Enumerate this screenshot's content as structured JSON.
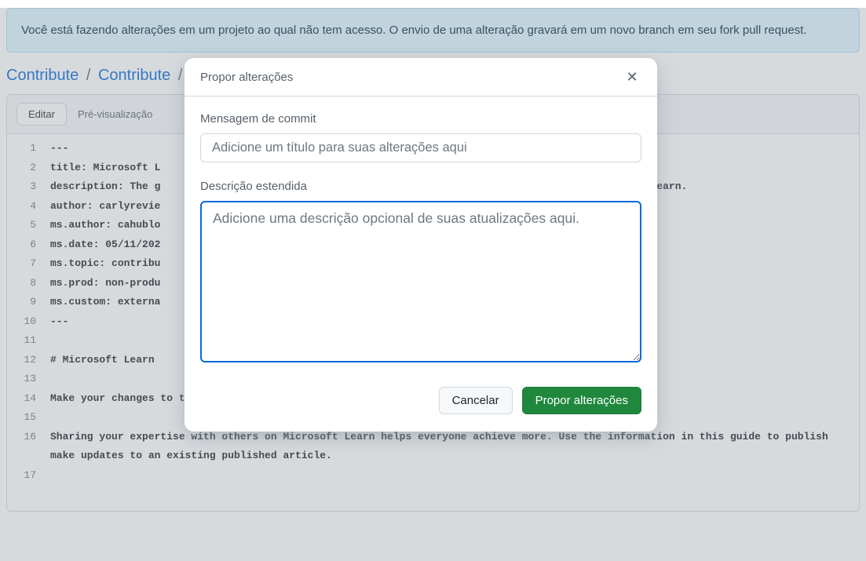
{
  "notice": {
    "text": "Você está fazendo alterações em um projeto ao qual não tem acesso. O envio de uma alteração gravará em um novo branch em seu fork pull request."
  },
  "breadcrumb": {
    "parts": [
      "Contribute",
      "Contribute"
    ],
    "sep": "/"
  },
  "tabs": {
    "edit": "Editar",
    "preview": "Pré-visualização"
  },
  "code": {
    "lineNumbers": [
      "1",
      "2",
      "3",
      "4",
      "5",
      "6",
      "7",
      "8",
      "9",
      "10",
      "11",
      "12",
      "13",
      "14",
      "15",
      "16",
      "",
      "17"
    ],
    "lines": [
      "---",
      "title: Microsoft L",
      "description: The g                                                                           soft Learn.",
      "author: carlyrevie",
      "ms.author: cahublo",
      "ms.date: 05/11/202",
      "ms.topic: contribu",
      "ms.prod: non-produ",
      "ms.custom: externa",
      "---",
      "",
      "# Microsoft Learn",
      "",
      "Make your changes to the article. Welcome to the Microsoft Learn documentation contributor guide!",
      "",
      "Sharing your expertise with others on Microsoft Learn helps everyone achieve more. Use the information in this guide to publish make updates to an existing published article.",
      "",
      ""
    ]
  },
  "modal": {
    "title": "Propor alterações",
    "commit_label": "Mensagem de commit",
    "commit_placeholder": "Adicione um título para suas alterações aqui",
    "commit_value": "",
    "desc_label": "Descrição estendida",
    "desc_placeholder": "Adicione uma descrição opcional de suas atualizações aqui.",
    "desc_value": "",
    "cancel": "Cancelar",
    "submit": "Propor alterações"
  }
}
